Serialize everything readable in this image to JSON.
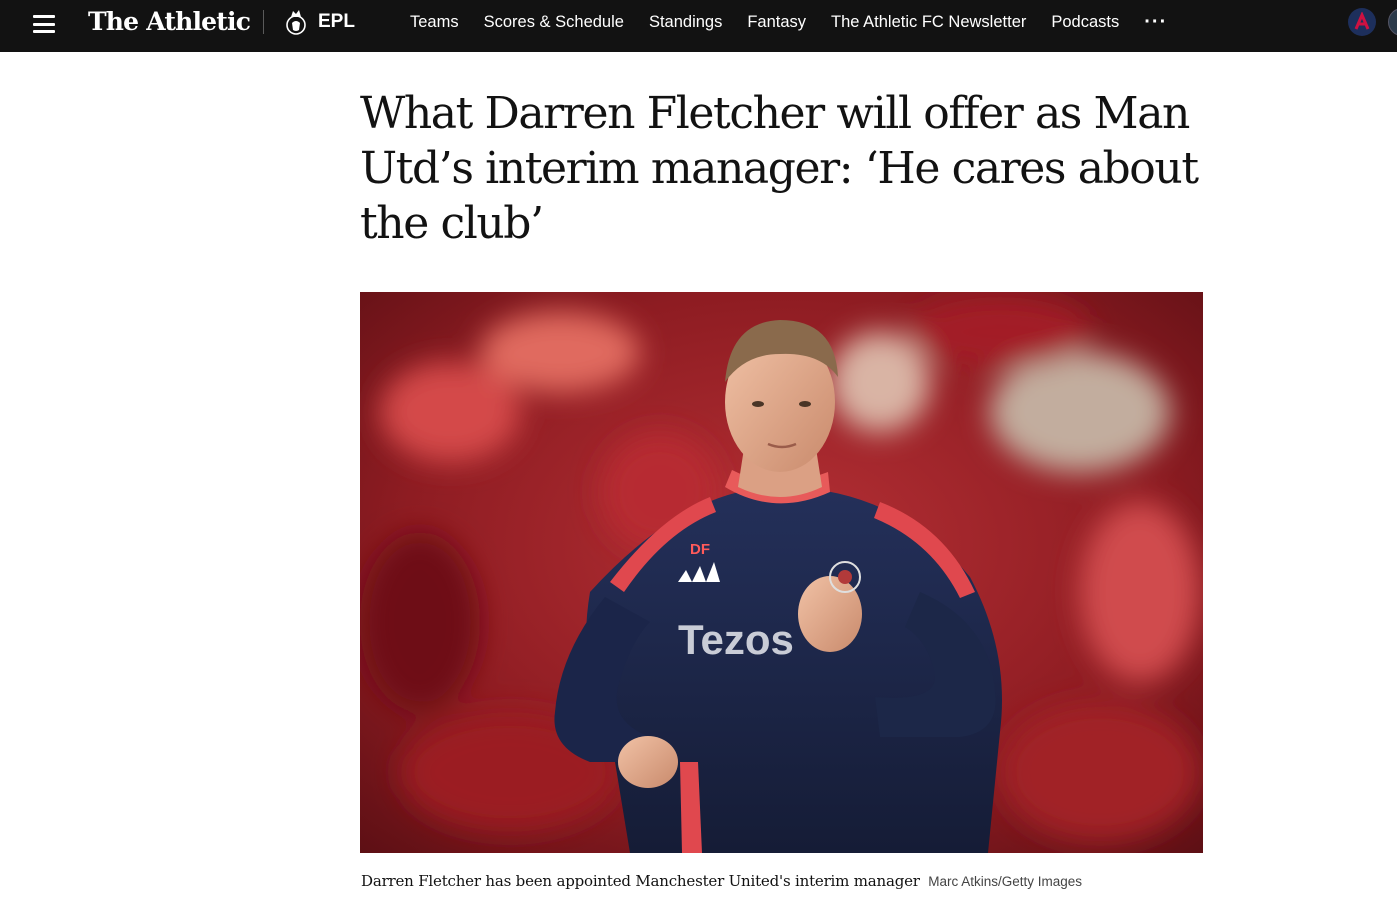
{
  "header": {
    "brand": "The Athletic",
    "league": "EPL",
    "nav": [
      "Teams",
      "Scores & Schedule",
      "Standings",
      "Fantasy",
      "The Athletic FC Newsletter",
      "Podcasts"
    ],
    "more": "···",
    "icons": {
      "menu": "hamburger-menu-icon",
      "league_logo": "premier-league-lion-icon",
      "team": "team-badge-icon"
    }
  },
  "article": {
    "headline": "What Darren Fletcher will offer as Man Utd’s interim manager: ‘He cares about the club’",
    "image": {
      "shirt_initials": "DF",
      "shirt_sponsor": "Tezos"
    },
    "caption": "Darren Fletcher has been appointed Manchester United's interim manager",
    "credit": "Marc Atkins/Getty Images"
  },
  "colors": {
    "topbar": "#121212",
    "text": "#121212",
    "jacket": "#1c2747",
    "accent": "#f24e4e"
  }
}
